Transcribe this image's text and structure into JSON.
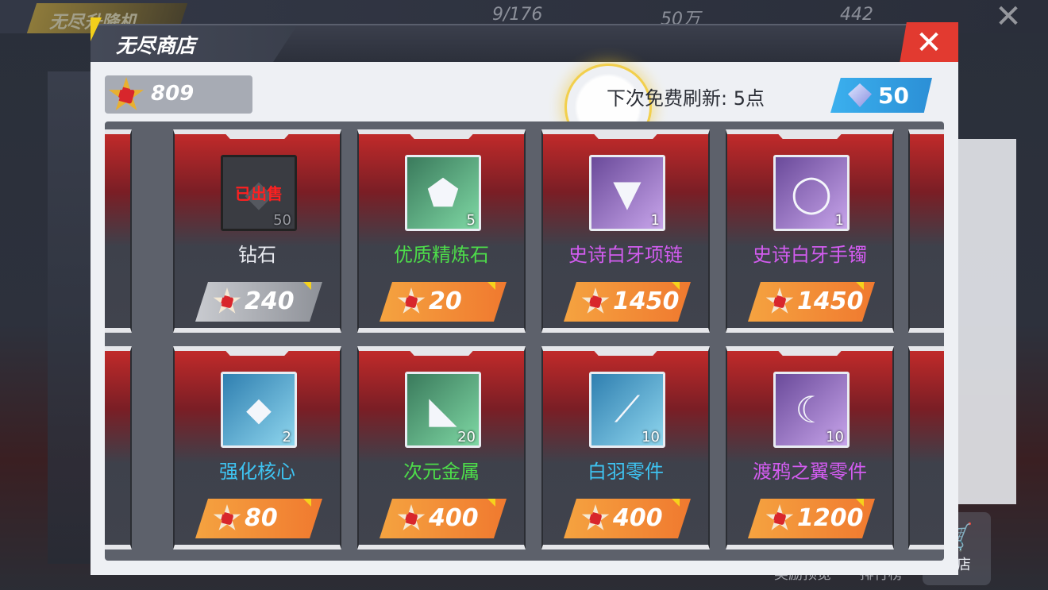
{
  "hud": {
    "title": "无尽升降机",
    "resources": [
      "9/176",
      "50万",
      "442"
    ],
    "bottom_labels": [
      "奖励预览",
      "排行榜",
      "商店"
    ]
  },
  "dialog": {
    "title": "无尽商店",
    "close_label": "✕",
    "currency_value": "809",
    "refresh_text": "下次免费刷新: 5点",
    "refresh_cost": "50"
  },
  "colors": {
    "accent_yellow": "#f2cf1b",
    "close_red": "#e23a30",
    "price_orange": "#f0792f",
    "refresh_blue": "#3bb0ee",
    "name_white": "#e8eaf0",
    "name_green": "#4ddc4a",
    "name_purple": "#d35cf0",
    "name_blue": "#3ec4f2",
    "sold_red": "#ff2020"
  },
  "items": [
    {
      "name": "钻石",
      "qty": "50",
      "price": "240",
      "sold": true,
      "sold_label": "已出售",
      "rarity": "white",
      "icon": "gem-icon"
    },
    {
      "name": "优质精炼石",
      "qty": "5",
      "price": "20",
      "sold": false,
      "rarity": "green",
      "icon": "refine-stone-icon"
    },
    {
      "name": "史诗白牙项链",
      "qty": "1",
      "price": "1450",
      "sold": false,
      "rarity": "purple",
      "icon": "necklace-icon"
    },
    {
      "name": "史诗白牙手镯",
      "qty": "1",
      "price": "1450",
      "sold": false,
      "rarity": "purple",
      "icon": "bracelet-icon"
    },
    {
      "name": "强化核心",
      "qty": "2",
      "price": "80",
      "sold": false,
      "rarity": "blue",
      "icon": "crystal-core-icon"
    },
    {
      "name": "次元金属",
      "qty": "20",
      "price": "400",
      "sold": false,
      "rarity": "green",
      "icon": "metal-icon"
    },
    {
      "name": "白羽零件",
      "qty": "10",
      "price": "400",
      "sold": false,
      "rarity": "blue",
      "icon": "feather-icon"
    },
    {
      "name": "渡鸦之翼零件",
      "qty": "10",
      "price": "1200",
      "sold": false,
      "rarity": "purple",
      "icon": "raven-wing-icon"
    }
  ]
}
